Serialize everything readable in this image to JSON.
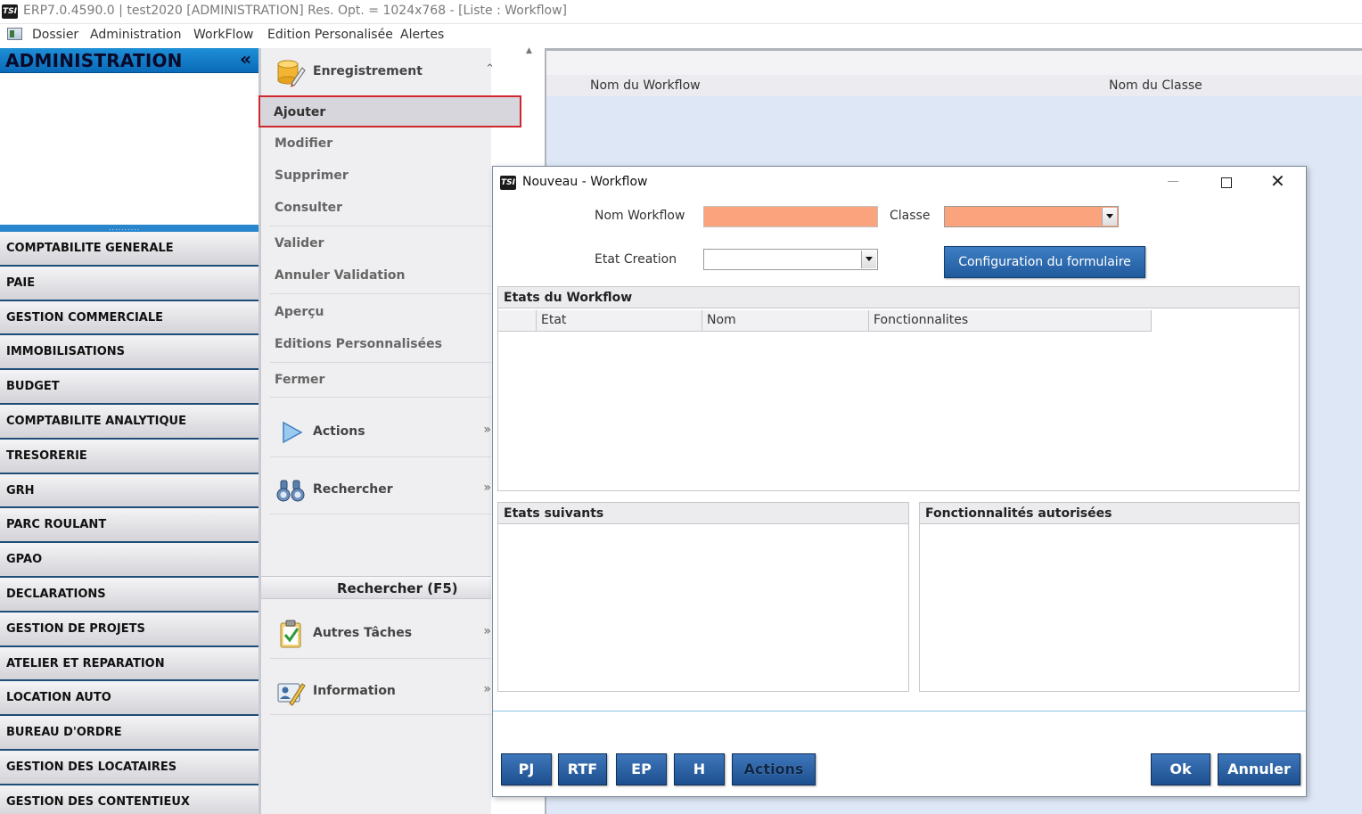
{
  "window": {
    "title": "ERP7.0.4590.0 | test2020 [ADMINISTRATION] Res. Opt. = 1024x768 - [Liste : Workflow]",
    "logo_text": "TSI"
  },
  "menu": [
    "Dossier",
    "Administration",
    "WorkFlow",
    "Edition Personalisée",
    "Alertes"
  ],
  "sidebar": {
    "header": "ADMINISTRATION",
    "collapse_glyph": "«",
    "splitter_dots": "..........",
    "modules": [
      "COMPTABILITE GENERALE",
      "PAIE",
      "GESTION COMMERCIALE",
      "IMMOBILISATIONS",
      "BUDGET",
      "COMPTABILITE ANALYTIQUE",
      "TRESORERIE",
      "GRH",
      "PARC ROULANT",
      "GPAO",
      "DECLARATIONS",
      "GESTION DE PROJETS",
      "ATELIER ET REPARATION",
      "LOCATION AUTO",
      "BUREAU D'ORDRE",
      "GESTION DES LOCATAIRES",
      "GESTION DES CONTENTIEUX"
    ]
  },
  "tasks": {
    "enregistrement": {
      "title": "Enregistrement",
      "items": [
        "Ajouter",
        "Modifier",
        "Supprimer",
        "Consulter",
        "Valider",
        "Annuler Validation",
        "Aperçu",
        "Editions Personnalisées",
        "Fermer"
      ],
      "selected": "Ajouter"
    },
    "actions_title": "Actions",
    "rechercher_title": "Rechercher",
    "search_bar": "Rechercher (F5)",
    "autres_title": "Autres Tâches",
    "information_title": "Information"
  },
  "list": {
    "columns": [
      "Nom du Workflow",
      "Nom du Classe"
    ]
  },
  "dialog": {
    "title": "Nouveau - Workflow",
    "nom_workflow_label": "Nom Workflow",
    "nom_workflow_value": "",
    "classe_label": "Classe",
    "classe_value": "",
    "etat_creation_label": "Etat Creation",
    "etat_creation_value": "",
    "config_button": "Configuration du formulaire",
    "etats_panel": {
      "title": "Etats du Workflow",
      "columns": [
        "Etat",
        "Nom",
        "Fonctionnalites"
      ]
    },
    "etats_suivants_title": "Etats suivants",
    "fonctionnalites_title": "Fonctionnalités autorisées",
    "footer_buttons": [
      "PJ",
      "RTF",
      "EP",
      "H",
      "Actions"
    ],
    "ok_label": "Ok",
    "cancel_label": "Annuler"
  },
  "colors": {
    "accent_blue": "#1f5a9c",
    "required_field": "#fba37d",
    "selection_outline": "#d0282d"
  }
}
